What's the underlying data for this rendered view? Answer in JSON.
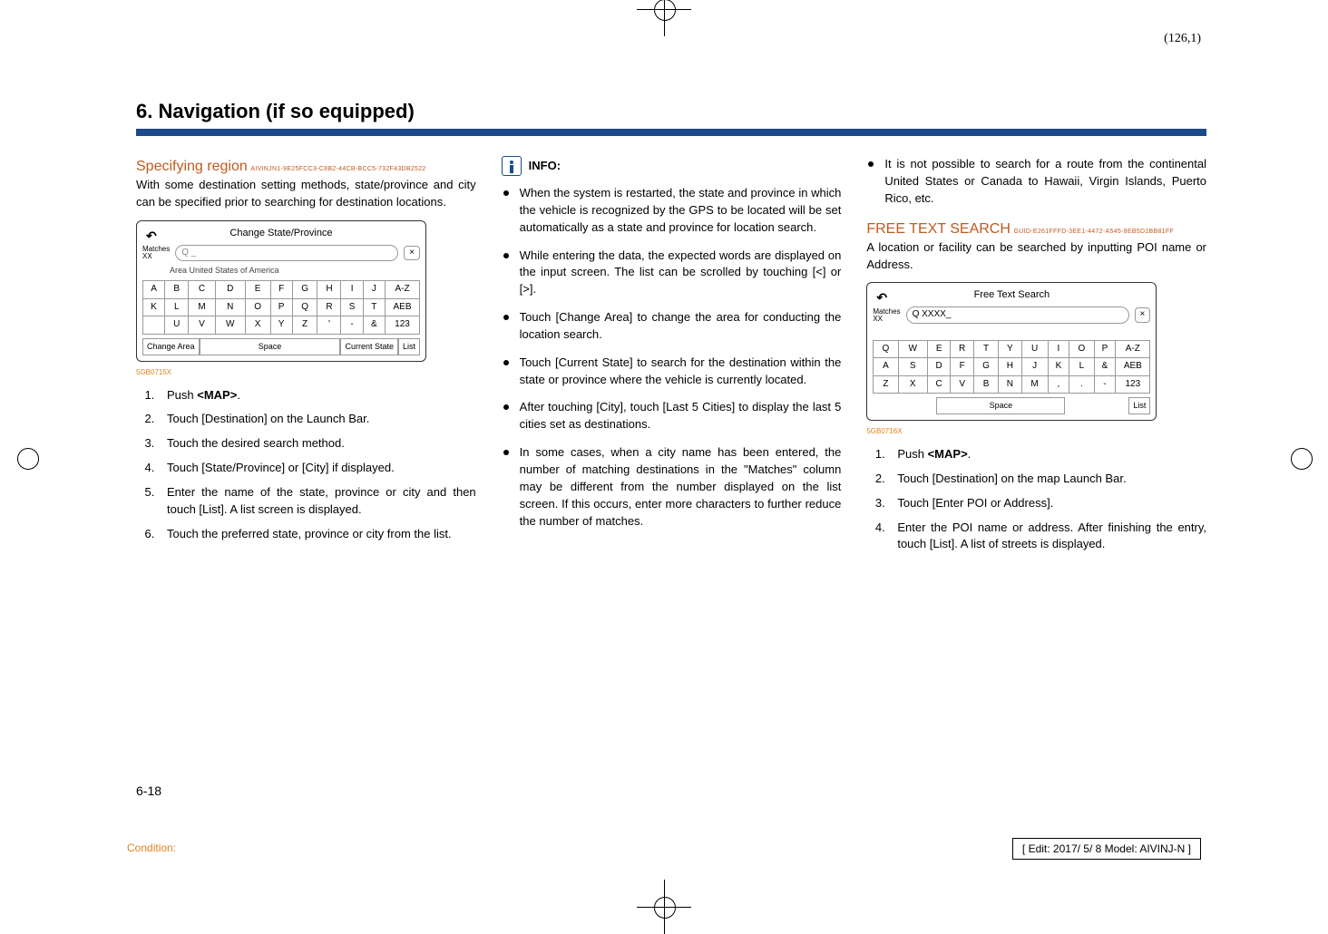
{
  "coords": "(126,1)",
  "chapter_title": "6. Navigation (if so equipped)",
  "col1": {
    "heading": "Specifying region",
    "guid": "AIVINJN1-9E25FCC3-C8B2-44CB-BCC5-732F43DB2522",
    "intro": "With some destination setting methods, state/province and city can be specified prior to searching for destination locations.",
    "ss": {
      "title": "Change State/Province",
      "matches_label": "Matches",
      "matches_val": "XX",
      "search_placeholder": "Q _",
      "area": "Area United States of America",
      "row1": [
        "A",
        "B",
        "C",
        "D",
        "E",
        "F",
        "G",
        "H",
        "I",
        "J",
        "A-Z"
      ],
      "row2": [
        "K",
        "L",
        "M",
        "N",
        "O",
        "P",
        "Q",
        "R",
        "S",
        "T",
        "AEB"
      ],
      "row3": [
        "",
        "U",
        "V",
        "W",
        "X",
        "Y",
        "Z",
        "'",
        "-",
        "&",
        "123"
      ],
      "btn_change": "Change Area",
      "btn_space": "Space",
      "btn_current": "Current State",
      "btn_list": "List"
    },
    "img_ref": "5GB0715X",
    "steps": [
      "Push <MAP>.",
      "Touch [Destination] on the Launch Bar.",
      "Touch the desired search method.",
      "Touch [State/Province] or [City] if displayed.",
      "Enter the name of the state, province or city and then touch [List]. A list screen is displayed.",
      "Touch the preferred state, province or city from the list."
    ]
  },
  "col2": {
    "info_label": "INFO:",
    "bullets": [
      "When the system is restarted, the state and province in which the vehicle is recognized by the GPS to be located will be set automatically as a state and province for location search.",
      "While entering the data, the expected words are displayed on the input screen. The list can be scrolled by touching [<] or [>].",
      "Touch [Change Area] to change the area for conducting the location search.",
      "Touch [Current State] to search for the destination within the state or province where the vehicle is currently located.",
      "After touching [City], touch [Last 5 Cities] to display the last 5 cities set as destinations.",
      "In some cases, when a city name has been entered, the number of matching destinations in the \"Matches\" column may be different from the number displayed on the list screen. If this occurs, enter more characters to further reduce the number of matches."
    ]
  },
  "col3": {
    "top_bullet": "It is not possible to search for a route from the continental United States or Canada to Hawaii, Virgin Islands, Puerto Rico, etc.",
    "heading": "FREE TEXT SEARCH",
    "guid": "GUID-E261FFFD-3EE1-4472-A545-8EB5D1BB81FF",
    "intro": "A location or facility can be searched by inputting POI name or Address.",
    "ss": {
      "title": "Free Text Search",
      "matches_label": "Matches",
      "matches_val": "XX",
      "search_text": "Q XXXX_",
      "row1": [
        "Q",
        "W",
        "E",
        "R",
        "T",
        "Y",
        "U",
        "I",
        "O",
        "P",
        "A-Z"
      ],
      "row2": [
        "A",
        "S",
        "D",
        "F",
        "G",
        "H",
        "J",
        "K",
        "L",
        "&",
        "AEB"
      ],
      "row3": [
        "Z",
        "X",
        "C",
        "V",
        "B",
        "N",
        "M",
        ",",
        ".",
        "-",
        "123"
      ],
      "btn_space": "Space",
      "btn_list": "List"
    },
    "img_ref": "5GB0716X",
    "steps": [
      "Push <MAP>.",
      "Touch [Destination] on the map Launch Bar.",
      "Touch [Enter POI or Address].",
      " Enter the POI name or address. After finishing the entry, touch [List]. A list of streets is displayed."
    ]
  },
  "page_num": "6-18",
  "condition": "Condition:",
  "edit": "[ Edit: 2017/ 5/ 8    Model: AIVINJ-N ]"
}
